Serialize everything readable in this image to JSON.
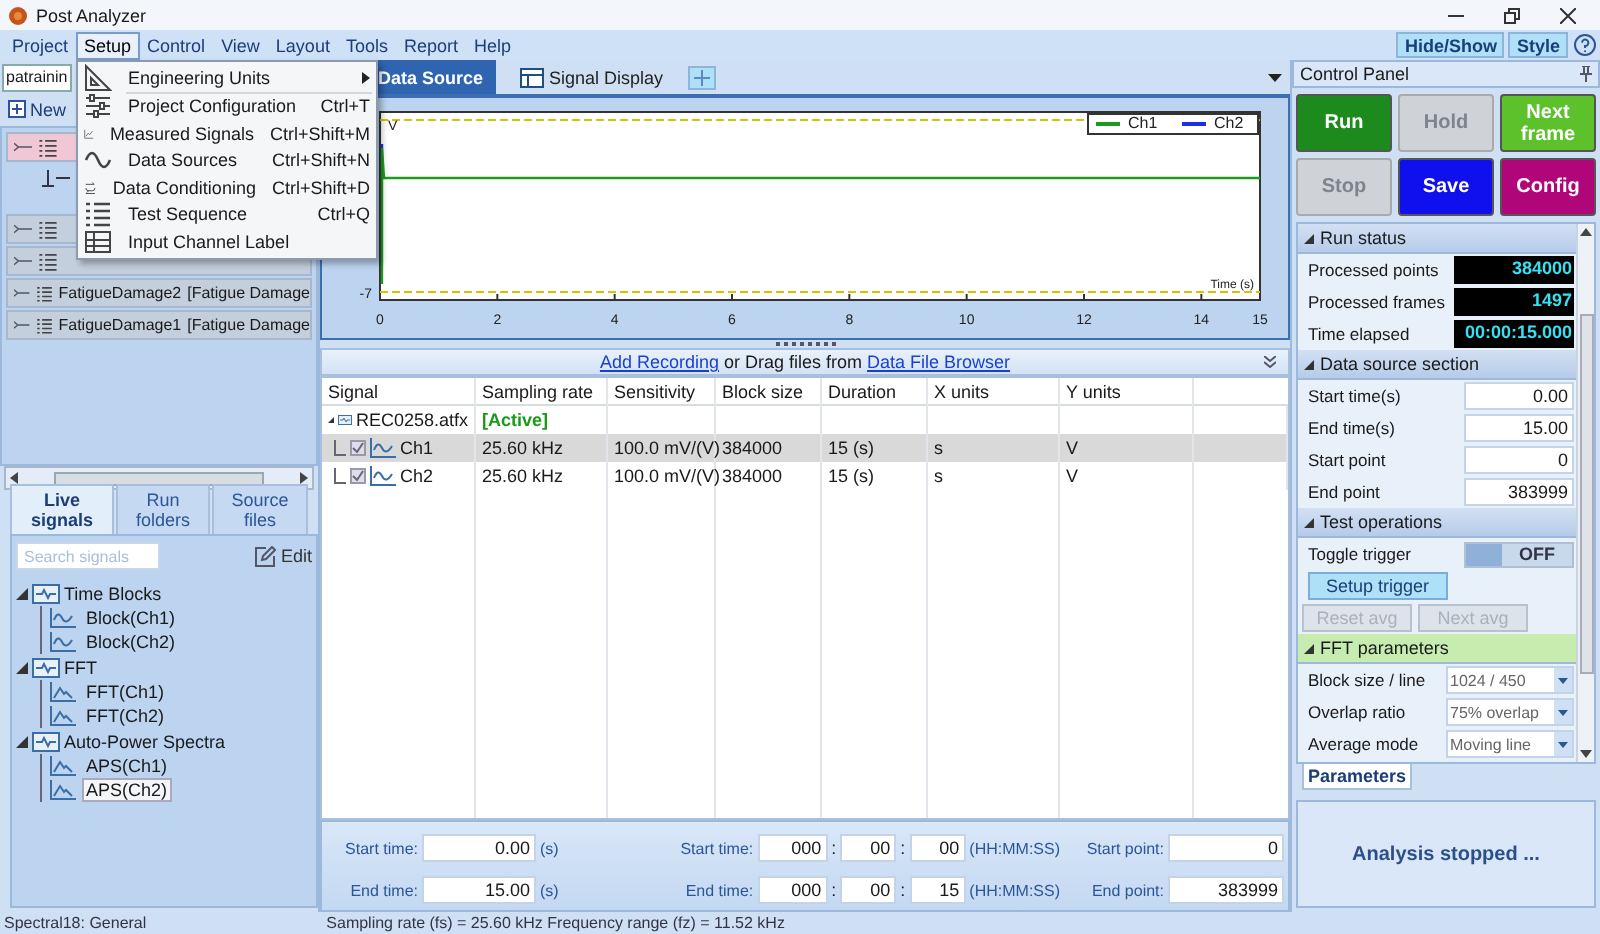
{
  "window": {
    "title": "Post Analyzer"
  },
  "menu_bar": [
    {
      "label": "Project",
      "selected": false
    },
    {
      "label": "Setup",
      "selected": true
    },
    {
      "label": "Control",
      "selected": false
    },
    {
      "label": "View",
      "selected": false
    },
    {
      "label": "Layout",
      "selected": false
    },
    {
      "label": "Tools",
      "selected": false
    },
    {
      "label": "Report",
      "selected": false
    },
    {
      "label": "Help",
      "selected": false
    }
  ],
  "toolbar": [
    "Hide/Show",
    "Style"
  ],
  "setup_menu": [
    {
      "label": "Engineering Units",
      "submenu": true
    },
    {
      "label": "Project Configuration",
      "shortcut": "Ctrl+T",
      "submenu": false
    },
    {
      "label": "Measured Signals",
      "shortcut": "Ctrl+Shift+M",
      "submenu": false
    },
    {
      "label": "Data Sources",
      "shortcut": "Ctrl+Shift+N",
      "submenu": false
    },
    {
      "label": "Data Conditioning",
      "shortcut": "Ctrl+Shift+D",
      "submenu": false
    },
    {
      "label": "Test Sequence",
      "shortcut": "Ctrl+Q",
      "submenu": false
    },
    {
      "label": "Input Channel Label",
      "submenu": false
    }
  ],
  "left": {
    "project": "patrainin",
    "new_label": "New",
    "projects": [
      {
        "selected": true,
        "children": [
          {
            "selected": false
          }
        ]
      },
      {
        "selected": false
      },
      {
        "selected": false
      },
      {
        "name": "FatigueDamage2",
        "type": "[Fatigue Damage",
        "selected": false
      },
      {
        "name": "FatigueDamage1",
        "type": "[Fatigue Damage",
        "selected": false
      }
    ],
    "tabs": [
      {
        "label": "Live signals",
        "selected": true
      },
      {
        "label": "Run folders",
        "selected": false
      },
      {
        "label": "Source files",
        "selected": false
      }
    ],
    "search": {
      "placeholder": "Search signals"
    },
    "edit_label": "Edit",
    "signals": [
      {
        "label": "Time Blocks",
        "expanded": true,
        "children": [
          {
            "label": "Block(Ch1)",
            "kind": "time",
            "selected": false
          },
          {
            "label": "Block(Ch2)",
            "kind": "time",
            "selected": false
          }
        ]
      },
      {
        "label": "FFT",
        "expanded": true,
        "children": [
          {
            "label": "FFT(Ch1)",
            "kind": "spectrum",
            "selected": false
          },
          {
            "label": "FFT(Ch2)",
            "kind": "spectrum",
            "selected": false
          }
        ]
      },
      {
        "label": "Auto-Power Spectra",
        "expanded": true,
        "children": [
          {
            "label": "APS(Ch1)",
            "kind": "spectrum",
            "selected": false
          },
          {
            "label": "APS(Ch2)",
            "kind": "spectrum",
            "selected": true
          }
        ]
      }
    ]
  },
  "center": {
    "tabs": [
      {
        "label": "Data Source",
        "selected": true
      },
      {
        "label": "Signal Display",
        "selected": false
      }
    ],
    "plot": {
      "y_unit": "V",
      "y_tick": "-7",
      "x_ticks": [
        "0",
        "2",
        "4",
        "6",
        "8",
        "10",
        "12",
        "14",
        "15"
      ],
      "x_label": "Time (s)",
      "legend": [
        {
          "name": "Ch1",
          "color": "#1e9a1e"
        },
        {
          "name": "Ch2",
          "color": "#1f2fe6"
        }
      ]
    },
    "recording_bar": {
      "link_1": "Add Recording",
      "middle": " or Drag files from ",
      "link_2": "Data File Browser"
    },
    "table": {
      "columns": [
        "Signal",
        "Sampling rate",
        "Sensitivity",
        "Block size",
        "Duration",
        "X units",
        "Y units"
      ],
      "recordings": [
        {
          "name": "REC0258.atfx",
          "status": "[Active]",
          "expanded": true,
          "channels": [
            {
              "name": "Ch1",
              "checked": true,
              "selected": true,
              "cells": [
                "25.60 kHz",
                "100.0 mV/(V)",
                "384000",
                "15 (s)",
                "s",
                "V"
              ]
            },
            {
              "name": "Ch2",
              "checked": true,
              "selected": false,
              "cells": [
                "25.60 kHz",
                "100.0 mV/(V)",
                "384000",
                "15 (s)",
                "s",
                "V"
              ]
            }
          ]
        }
      ]
    },
    "range": {
      "separator": ":",
      "rows": [
        {
          "label": "Start time:",
          "seconds": "0.00",
          "unit": "(s)",
          "hms_label": "Start time:",
          "hms": [
            "000",
            "00",
            "00"
          ],
          "hms_unit": "(HH:MM:SS)",
          "point_label": "Start point:",
          "point": "0"
        },
        {
          "label": "End time:",
          "seconds": "15.00",
          "unit": "(s)",
          "hms_label": "End time:",
          "hms": [
            "000",
            "00",
            "15"
          ],
          "hms_unit": "(HH:MM:SS)",
          "point_label": "End point:",
          "point": "383999"
        }
      ]
    }
  },
  "control_panel": {
    "title": "Control Panel",
    "buttons": [
      {
        "label": "Run",
        "color": "#1c8a1c",
        "disabled": false
      },
      {
        "label": "Hold",
        "disabled": true
      },
      {
        "label": "Next frame",
        "color": "#5dc12b",
        "disabled": false
      },
      {
        "label": "Stop",
        "disabled": true
      },
      {
        "label": "Save",
        "color": "#1010ee",
        "disabled": false
      },
      {
        "label": "Config",
        "color": "#b0067a",
        "disabled": false
      }
    ],
    "sections": [
      {
        "title": "Run status",
        "selected": false,
        "rows": [
          {
            "kind": "readout",
            "label": "Processed points",
            "value": "384000"
          },
          {
            "kind": "readout",
            "label": "Processed frames",
            "value": "1497"
          },
          {
            "kind": "readout",
            "label": "Time elapsed",
            "value": "00:00:15.000"
          }
        ]
      },
      {
        "title": "Data source section",
        "selected": false,
        "rows": [
          {
            "kind": "field",
            "label": "Start time(s)",
            "value": "0.00"
          },
          {
            "kind": "field",
            "label": "End time(s)",
            "value": "15.00"
          },
          {
            "kind": "field",
            "label": "Start point",
            "value": "0"
          },
          {
            "kind": "field",
            "label": "End point",
            "value": "383999"
          }
        ]
      },
      {
        "title": "Test operations",
        "selected": false,
        "rows": [
          {
            "kind": "toggle",
            "label": "Toggle trigger",
            "value": "OFF",
            "on": false
          },
          {
            "kind": "button",
            "label": "Setup trigger",
            "disabled": false
          },
          {
            "kind": "button_pair",
            "buttons": [
              {
                "label": "Reset avg",
                "disabled": true
              },
              {
                "label": "Next avg",
                "disabled": true
              }
            ]
          }
        ]
      },
      {
        "title": "FFT parameters",
        "selected": true,
        "rows": [
          {
            "kind": "dropdown",
            "label": "Block size / line",
            "value": "1024 / 450"
          },
          {
            "kind": "dropdown",
            "label": "Overlap ratio",
            "value": "75% overlap"
          },
          {
            "kind": "dropdown",
            "label": "Average mode",
            "value": "Moving line"
          }
        ]
      }
    ],
    "tabs": [
      {
        "label": "Parameters",
        "selected": true
      }
    ],
    "status": "Analysis stopped ..."
  },
  "status_bar": [
    "Spectral18: General",
    "Sampling rate (fs) = 25.60 kHz  Frequency range (fz) = 11.52 kHz"
  ]
}
